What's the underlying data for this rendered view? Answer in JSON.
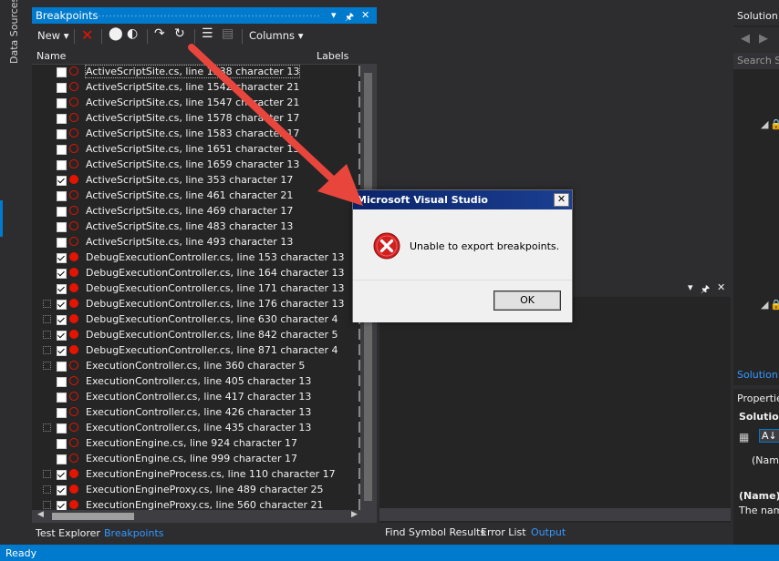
{
  "left_strip": {
    "vertical_tab": "Data Sources"
  },
  "breakpoints": {
    "title": "Breakpoints",
    "toolbar": {
      "new_label": "New",
      "columns_label": "Columns"
    },
    "columns": {
      "name": "Name",
      "labels": "Labels"
    },
    "rows": [
      {
        "label": "ActiveScriptSite.cs, line 1538 character 13",
        "checked": false,
        "enabled": false,
        "tree": false
      },
      {
        "label": "ActiveScriptSite.cs, line 1542 character 21",
        "checked": false,
        "enabled": false,
        "tree": false
      },
      {
        "label": "ActiveScriptSite.cs, line 1547 character 21",
        "checked": false,
        "enabled": false,
        "tree": false
      },
      {
        "label": "ActiveScriptSite.cs, line 1578 character 17",
        "checked": false,
        "enabled": false,
        "tree": false
      },
      {
        "label": "ActiveScriptSite.cs, line 1583 character 17",
        "checked": false,
        "enabled": false,
        "tree": false
      },
      {
        "label": "ActiveScriptSite.cs, line 1651 character 13",
        "checked": false,
        "enabled": false,
        "tree": false
      },
      {
        "label": "ActiveScriptSite.cs, line 1659 character 13",
        "checked": false,
        "enabled": false,
        "tree": false
      },
      {
        "label": "ActiveScriptSite.cs, line 353 character 17",
        "checked": true,
        "enabled": true,
        "tree": false
      },
      {
        "label": "ActiveScriptSite.cs, line 461 character 21",
        "checked": false,
        "enabled": false,
        "tree": false
      },
      {
        "label": "ActiveScriptSite.cs, line 469 character 17",
        "checked": false,
        "enabled": false,
        "tree": false
      },
      {
        "label": "ActiveScriptSite.cs, line 483 character 13",
        "checked": false,
        "enabled": false,
        "tree": false
      },
      {
        "label": "ActiveScriptSite.cs, line 493 character 13",
        "checked": false,
        "enabled": false,
        "tree": false
      },
      {
        "label": "DebugExecutionController.cs, line 153 character 13",
        "checked": true,
        "enabled": true,
        "tree": false
      },
      {
        "label": "DebugExecutionController.cs, line 164 character 13",
        "checked": true,
        "enabled": true,
        "tree": false
      },
      {
        "label": "DebugExecutionController.cs, line 171 character 13",
        "checked": true,
        "enabled": true,
        "tree": false
      },
      {
        "label": "DebugExecutionController.cs, line 176 character 13",
        "checked": true,
        "enabled": true,
        "tree": true
      },
      {
        "label": "DebugExecutionController.cs, line 630 character 4",
        "checked": true,
        "enabled": true,
        "tree": true
      },
      {
        "label": "DebugExecutionController.cs, line 842 character 5",
        "checked": true,
        "enabled": true,
        "tree": true
      },
      {
        "label": "DebugExecutionController.cs, line 871 character 4",
        "checked": true,
        "enabled": true,
        "tree": true
      },
      {
        "label": "ExecutionController.cs, line 360 character 5",
        "checked": false,
        "enabled": false,
        "tree": true
      },
      {
        "label": "ExecutionController.cs, line 405 character 13",
        "checked": false,
        "enabled": false,
        "tree": false
      },
      {
        "label": "ExecutionController.cs, line 417 character 13",
        "checked": false,
        "enabled": false,
        "tree": false
      },
      {
        "label": "ExecutionController.cs, line 426 character 13",
        "checked": false,
        "enabled": false,
        "tree": false
      },
      {
        "label": "ExecutionController.cs, line 435 character 13",
        "checked": false,
        "enabled": false,
        "tree": true
      },
      {
        "label": "ExecutionEngine.cs, line 924 character 17",
        "checked": false,
        "enabled": false,
        "tree": false
      },
      {
        "label": "ExecutionEngine.cs, line 999 character 17",
        "checked": false,
        "enabled": false,
        "tree": false
      },
      {
        "label": "ExecutionEngineProcess.cs, line 110 character 17",
        "checked": true,
        "enabled": true,
        "tree": true
      },
      {
        "label": "ExecutionEngineProxy.cs, line 489 character 25",
        "checked": true,
        "enabled": true,
        "tree": true
      },
      {
        "label": "ExecutionEngineProxy.cs, line 560 character 21",
        "checked": true,
        "enabled": true,
        "tree": true
      }
    ],
    "tabs": {
      "test_explorer": "Test Explorer",
      "breakpoints": "Breakpoints"
    }
  },
  "output": {
    "tabs": {
      "find_symbol": "Find Symbol Results",
      "error_list": "Error List",
      "output": "Output"
    }
  },
  "solution_explorer": {
    "title": "Solution E",
    "search_placeholder": "Search Sc",
    "footer": "Solution E"
  },
  "properties": {
    "title": "Properties",
    "object": "Solution",
    "row_name": "(Name",
    "desc_title": "(Name)",
    "desc_text": "The name"
  },
  "status": {
    "text": "Ready"
  },
  "dialog": {
    "title": "Microsoft Visual Studio",
    "message": "Unable to export breakpoints.",
    "ok_label": "OK",
    "close_glyph": "✕"
  },
  "colors": {
    "accent": "#007acc",
    "breakpoint": "#e51400",
    "arrow": "#e8463d"
  }
}
